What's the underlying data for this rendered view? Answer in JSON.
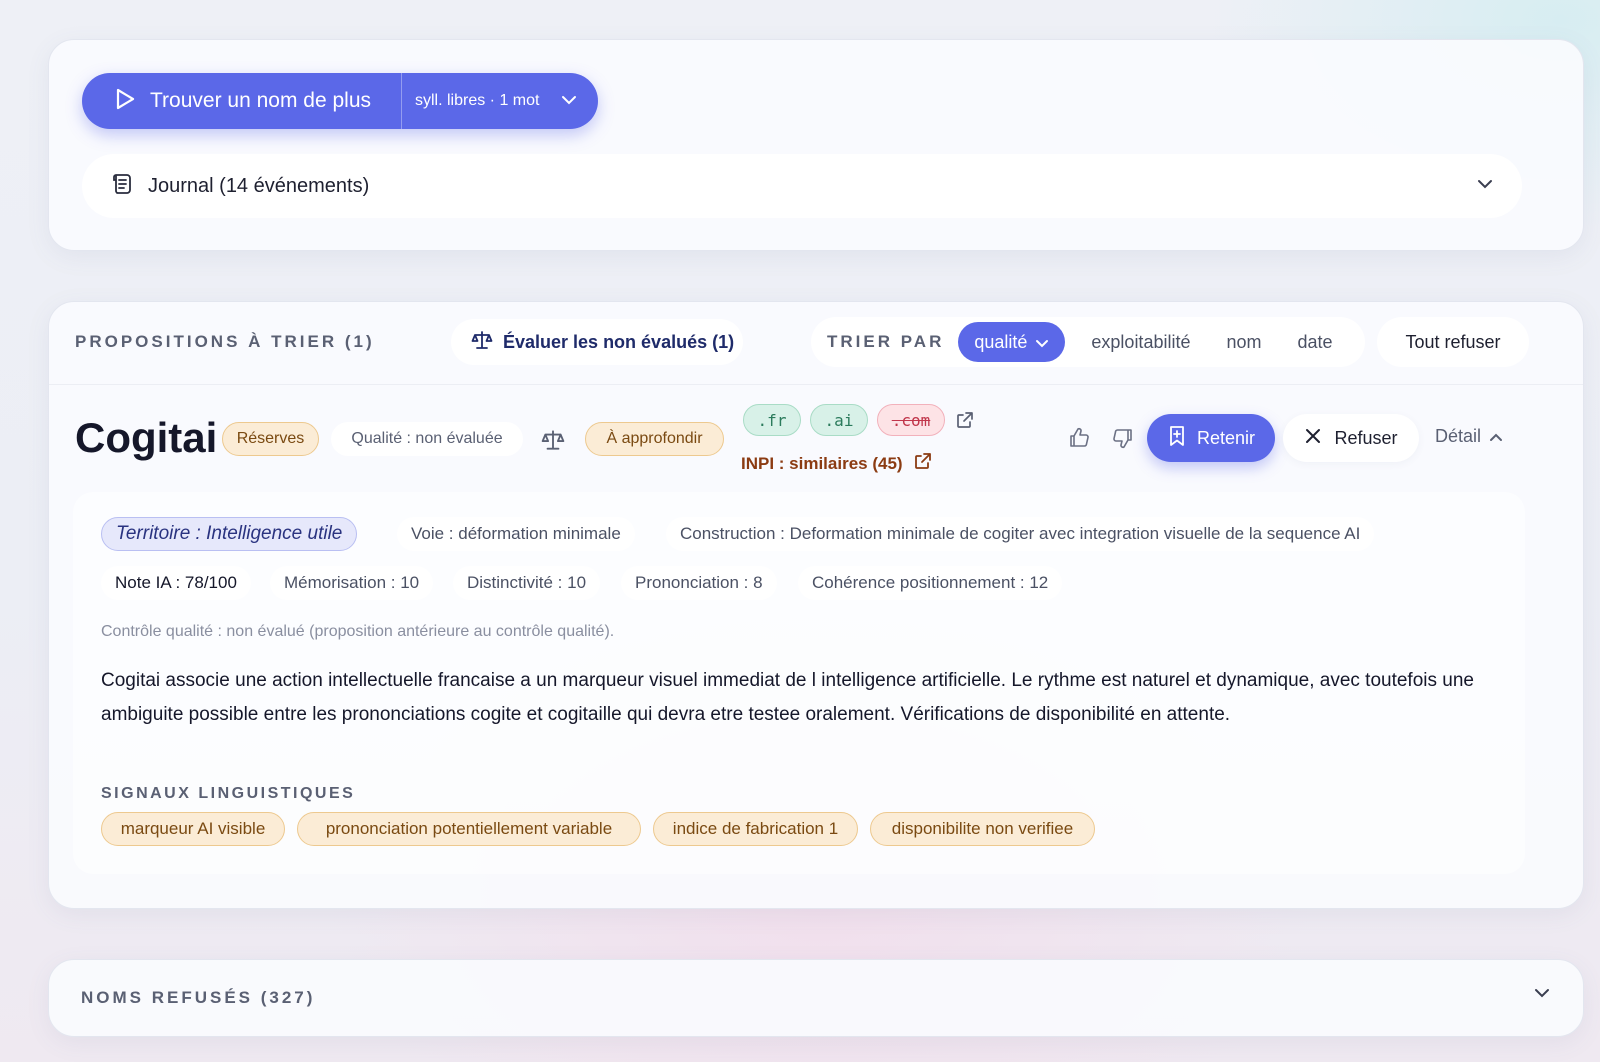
{
  "actions": {
    "find_label": "Trouver un nom de plus",
    "options_label": "syll. libres · 1 mot"
  },
  "journal": {
    "label": "Journal (14 événements)"
  },
  "proposals": {
    "title": "PROPOSITIONS À TRIER (1)",
    "evaluate_label": "Évaluer les non évalués (1)",
    "sort_label": "TRIER PAR",
    "sort_active": "qualité",
    "sort_options": [
      "exploitabilité",
      "nom",
      "date"
    ],
    "reject_all_label": "Tout refuser"
  },
  "candidate": {
    "name": "Cogitai",
    "status_badge": "Réserves",
    "quality_badge": "Qualité : non évaluée",
    "followup_badge": "À approfondir",
    "domains": [
      {
        "tld": ".fr",
        "available": true
      },
      {
        "tld": ".ai",
        "available": true
      },
      {
        "tld": ".com",
        "available": false
      }
    ],
    "inpi_label": "INPI : similaires (45)",
    "retain_label": "Retenir",
    "refuse_label": "Refuser",
    "detail_label": "Détail",
    "territory": "Territoire : Intelligence utile",
    "voie": "Voie : déformation minimale",
    "construction": "Construction : Deformation minimale de cogiter avec integration visuelle de la sequence AI",
    "scores": {
      "note_ia": "Note IA : 78/100",
      "memorisation": "Mémorisation : 10",
      "distinctivite": "Distinctivité : 10",
      "prononciation": "Prononciation : 8",
      "coherence": "Cohérence positionnement : 12"
    },
    "quality_control": "Contrôle qualité : non évalué (proposition antérieure au contrôle qualité).",
    "description": "Cogitai associe une action intellectuelle francaise a un marqueur visuel immediat de l intelligence artificielle. Le rythme est naturel et dynamique, avec toutefois une ambiguite possible entre les prononciations cogite et cogitaille qui devra etre testee oralement. Vérifications de disponibilité en attente.",
    "signals_title": "SIGNAUX LINGUISTIQUES",
    "signals": [
      "marqueur AI visible",
      "prononciation potentiellement variable",
      "indice de fabrication 1",
      "disponibilite non verifiee"
    ]
  },
  "refused": {
    "title": "NOMS REFUSÉS (327)"
  },
  "colors": {
    "accent": "#5b68e8",
    "amber_bg": "#fbecd6",
    "amber_text": "#7a4a12",
    "tld_ok": "#2b7b5c",
    "tld_ko": "#c1364b",
    "inpi": "#8b3b12"
  },
  "icons": {
    "find": "play-icon",
    "options": "chevron-down-icon",
    "journal": "scroll-icon",
    "evaluate": "scale-icon",
    "external": "external-link-icon",
    "like": "thumbs-up-icon",
    "dislike": "thumbs-down-icon",
    "retain": "bookmark-plus-icon",
    "refuse": "close-icon",
    "detail": "chevron-up-icon"
  }
}
